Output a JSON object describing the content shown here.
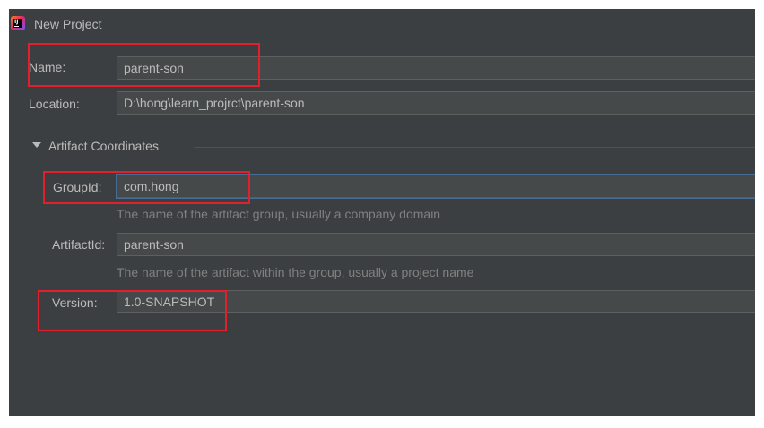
{
  "window": {
    "title": "New Project"
  },
  "form": {
    "name_label": "Name:",
    "name_value": "parent-son",
    "location_label": "Location:",
    "location_value": "D:\\hong\\learn_projrct\\parent-son"
  },
  "artifact": {
    "section_title": "Artifact Coordinates",
    "groupid_label": "GroupId:",
    "groupid_value": "com.hong",
    "groupid_hint": "The name of the artifact group, usually a company domain",
    "artifactid_label": "ArtifactId:",
    "artifactid_value": "parent-son",
    "artifactid_hint": "The name of the artifact within the group, usually a project name",
    "version_label": "Version:",
    "version_value": "1.0-SNAPSHOT"
  },
  "icons": {
    "app_icon": "intellij-idea-icon",
    "section_toggle": "triangle-down-icon"
  },
  "colors": {
    "background": "#3c3f41",
    "field_background": "#45494a",
    "text": "#bbbbbb",
    "hint_text": "#808080",
    "focus_border": "#466d94",
    "highlight_annotation": "#e0202a"
  }
}
